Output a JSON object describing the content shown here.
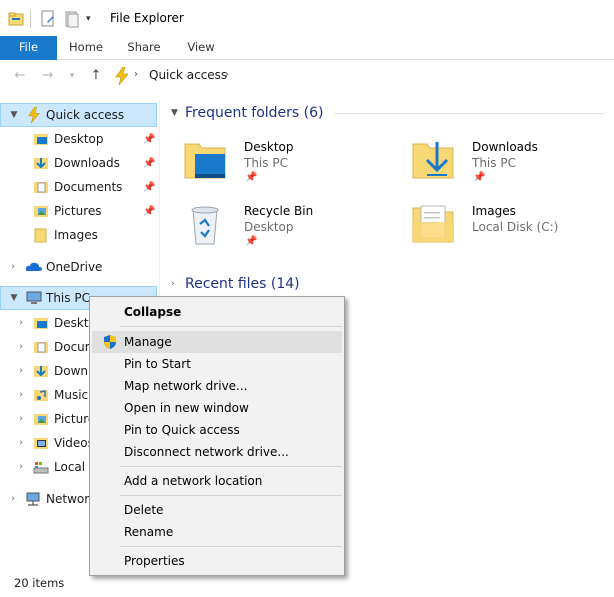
{
  "window": {
    "title": "File Explorer"
  },
  "ribbon": {
    "tabs": [
      "File",
      "Home",
      "Share",
      "View"
    ]
  },
  "address": {
    "breadcrumb": "Quick access"
  },
  "nav": {
    "quick_access": "Quick access",
    "quick_items": [
      "Desktop",
      "Downloads",
      "Documents",
      "Pictures",
      "Images"
    ],
    "onedrive": "OneDrive",
    "this_pc": "This PC",
    "pc_items": [
      "Deskto",
      "Docum",
      "Downl",
      "Music",
      "Picture",
      "Videos",
      "Local D"
    ],
    "network": "Network"
  },
  "content": {
    "frequent_header": "Frequent folders (6)",
    "recent_header": "Recent files (14)",
    "tiles": [
      {
        "name": "Desktop",
        "location": "This PC"
      },
      {
        "name": "Downloads",
        "location": "This PC"
      },
      {
        "name": "Recycle Bin",
        "location": "Desktop"
      },
      {
        "name": "Images",
        "location": "Local Disk (C:)"
      }
    ]
  },
  "context_menu": {
    "items": [
      "Collapse",
      "Manage",
      "Pin to Start",
      "Map network drive...",
      "Open in new window",
      "Pin to Quick access",
      "Disconnect network drive...",
      "Add a network location",
      "Delete",
      "Rename",
      "Properties"
    ]
  },
  "status": {
    "count": "20 items"
  },
  "colors": {
    "accent": "#1979ca",
    "selection": "#cce8ff",
    "folder": "#f8d775",
    "header_text": "#1e3287"
  }
}
